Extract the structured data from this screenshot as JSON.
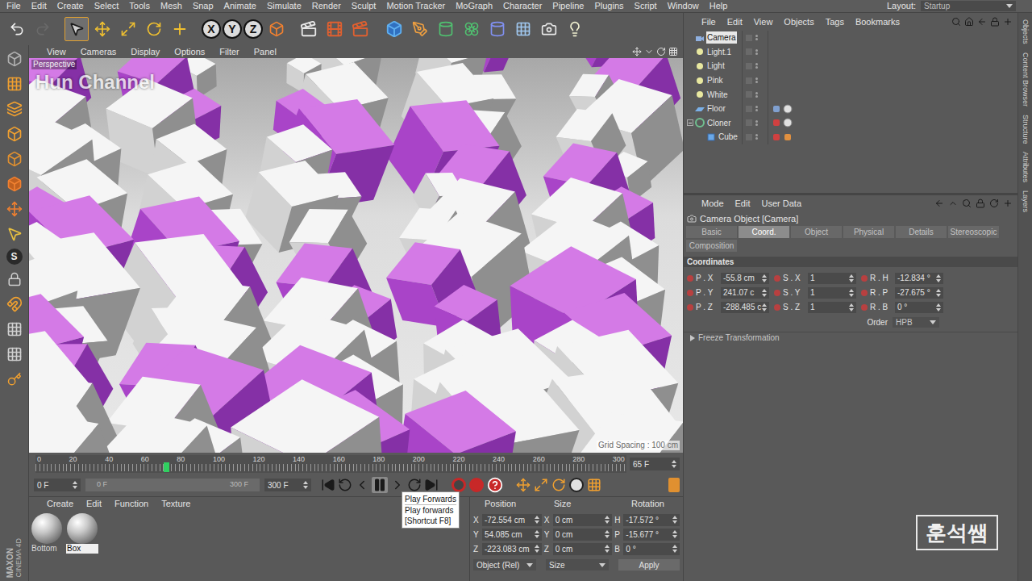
{
  "menubar": {
    "items": [
      "File",
      "Edit",
      "Create",
      "Select",
      "Tools",
      "Mesh",
      "Snap",
      "Animate",
      "Simulate",
      "Render",
      "Sculpt",
      "Motion Tracker",
      "MoGraph",
      "Character",
      "Pipeline",
      "Plugins",
      "Script",
      "Window",
      "Help"
    ],
    "layout_label": "Layout:",
    "layout_value": "Startup"
  },
  "toolbar": {
    "undo_disabled": false,
    "redo_disabled": true,
    "tools": [
      {
        "selected": true
      },
      {
        "selected": false
      },
      {
        "selected": false
      },
      {
        "selected": false
      },
      {
        "selected": false
      }
    ],
    "axes": [
      {
        "label": "X",
        "on": true
      },
      {
        "label": "Y",
        "on": true
      },
      {
        "label": "Z",
        "on": true
      }
    ]
  },
  "left_toolbar": {
    "tools": [
      {
        "selected": false
      },
      {
        "selected": false
      },
      {
        "selected": false
      },
      {
        "selected": false
      },
      {
        "selected": false
      },
      {
        "selected": false
      },
      {
        "selected": false
      },
      {
        "selected": false
      },
      {
        "selected": false
      },
      {
        "selected": false
      },
      {
        "selected": false
      },
      {
        "selected": false
      },
      {
        "selected": false
      }
    ],
    "snap_label": "S",
    "logo_brand": "MAXON",
    "logo_product": "CINEMA 4D"
  },
  "viewport": {
    "menu": [
      "View",
      "Cameras",
      "Display",
      "Options",
      "Filter",
      "Panel"
    ],
    "label": "Perspective",
    "watermark": "Hun Channel",
    "grid_spacing": "Grid Spacing : 100 cm"
  },
  "timeline": {
    "ticks": [
      "0",
      "20",
      "40",
      "60",
      "80",
      "100",
      "120",
      "140",
      "160",
      "180",
      "200",
      "220",
      "240",
      "260",
      "280",
      "300"
    ],
    "level": 0.2167,
    "current": "65 F"
  },
  "playback": {
    "start": "0 F",
    "range_start": "0 F",
    "range_end": "300 F",
    "end": "300 F",
    "range_level": 1,
    "hovered_button": "play"
  },
  "tooltip": {
    "title": "Play Forwards",
    "description": "Play forwards",
    "shortcut": "[Shortcut F8]"
  },
  "materials": {
    "menu": [
      "Create",
      "Edit",
      "Function",
      "Texture"
    ],
    "items": [
      {
        "name": "Bottom",
        "selected": false
      },
      {
        "name": "Box",
        "selected": true
      }
    ]
  },
  "coordinates": {
    "headers": [
      "Position",
      "Size",
      "Rotation"
    ],
    "rows": [
      {
        "axis": "X",
        "position": "-72.554 cm",
        "size_axis": "X",
        "size": "0 cm",
        "rot_axis": "H",
        "rotation": "-17.572 °"
      },
      {
        "axis": "Y",
        "position": "54.085 cm",
        "size_axis": "Y",
        "size": "0 cm",
        "rot_axis": "P",
        "rotation": "-15.677 °"
      },
      {
        "axis": "Z",
        "position": "-223.083 cm",
        "size_axis": "Z",
        "size": "0 cm",
        "rot_axis": "B",
        "rotation": "0 °"
      }
    ],
    "mode": "Object (Rel)",
    "size_mode": "Size",
    "apply": "Apply"
  },
  "object_manager": {
    "menu": [
      "File",
      "Edit",
      "View",
      "Objects",
      "Tags",
      "Bookmarks"
    ],
    "objects": [
      {
        "name": "Camera",
        "kind": "camera",
        "depth": 0,
        "selected": true,
        "expanded": false,
        "tags": []
      },
      {
        "name": "Light.1",
        "kind": "light",
        "depth": 0,
        "selected": false,
        "expanded": false,
        "tags": []
      },
      {
        "name": "Light",
        "kind": "light",
        "depth": 0,
        "selected": false,
        "expanded": false,
        "tags": []
      },
      {
        "name": "Pink",
        "kind": "light",
        "depth": 0,
        "selected": false,
        "expanded": false,
        "tags": []
      },
      {
        "name": "White",
        "kind": "light",
        "depth": 0,
        "selected": false,
        "expanded": false,
        "tags": []
      },
      {
        "name": "Floor",
        "kind": "floor",
        "depth": 0,
        "selected": false,
        "expanded": false,
        "tags": [
          "compositing",
          "material"
        ]
      },
      {
        "name": "Cloner",
        "kind": "cloner",
        "depth": 0,
        "selected": false,
        "expanded": true,
        "tags": [
          "dynamics",
          "material"
        ]
      },
      {
        "name": "Cube",
        "kind": "cube",
        "depth": 1,
        "selected": false,
        "expanded": false,
        "tags": [
          "dynamics",
          "phong"
        ]
      }
    ]
  },
  "attributes": {
    "menu": [
      "Mode",
      "Edit",
      "User Data"
    ],
    "title": "Camera Object [Camera]",
    "tabs": [
      {
        "label": "Basic",
        "selected": false
      },
      {
        "label": "Coord.",
        "selected": true
      },
      {
        "label": "Object",
        "selected": false
      },
      {
        "label": "Physical",
        "selected": false
      },
      {
        "label": "Details",
        "selected": false
      },
      {
        "label": "Stereoscopic",
        "selected": false
      },
      {
        "label": "Composition",
        "selected": false
      }
    ],
    "section": "Coordinates",
    "rows": [
      {
        "p_label": "P . X",
        "p_value": "-55.8 cm",
        "s_label": "S . X",
        "s_value": "1",
        "r_label": "R . H",
        "r_value": "-12.834 °"
      },
      {
        "p_label": "P . Y",
        "p_value": "241.07 c",
        "s_label": "S . Y",
        "s_value": "1",
        "r_label": "R . P",
        "r_value": "-27.675 °"
      },
      {
        "p_label": "P . Z",
        "p_value": "-288.485 c",
        "s_label": "S . Z",
        "s_value": "1",
        "r_label": "R . B",
        "r_value": "0 °"
      }
    ],
    "order_label": "Order",
    "order_value": "HPB",
    "freeze": "Freeze Transformation",
    "freeze_expanded": false
  },
  "side_tabs": [
    "Objects",
    "Content Browser",
    "Structure",
    "Attributes",
    "Layers"
  ],
  "badge": "훈석쌤"
}
